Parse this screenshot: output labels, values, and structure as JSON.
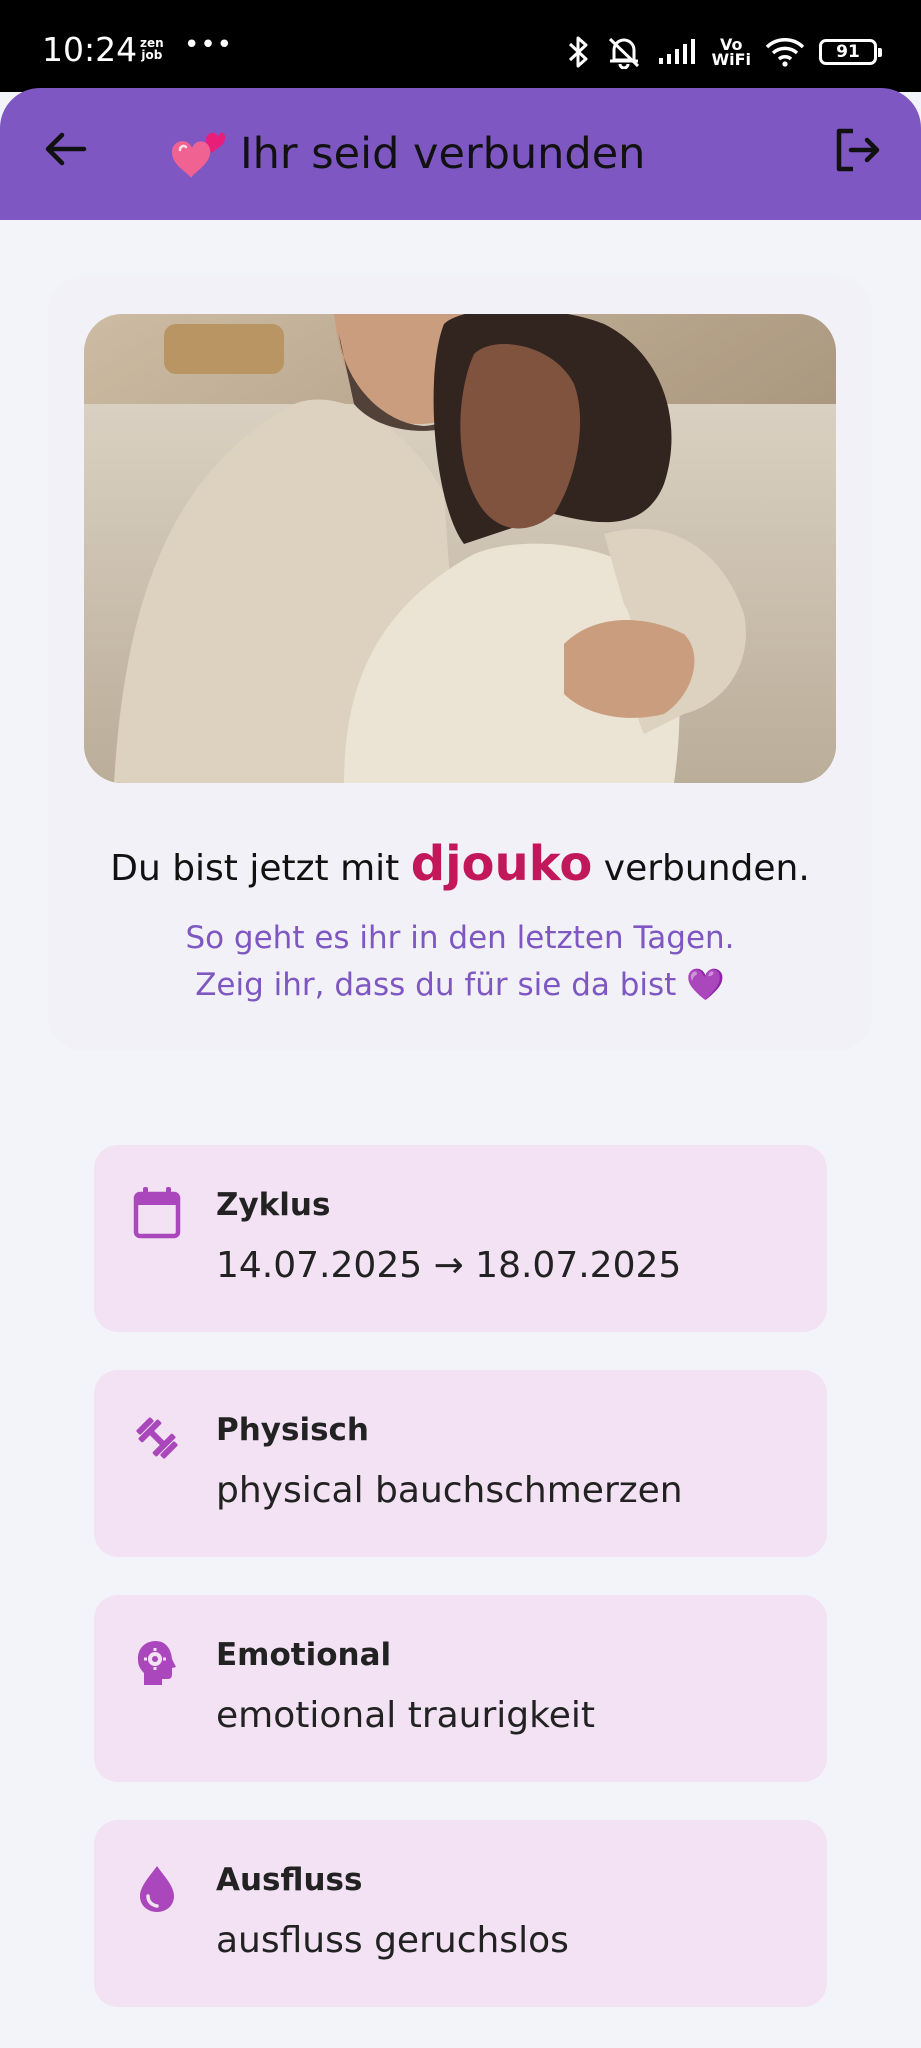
{
  "status_bar": {
    "time": "10:24",
    "carrier_badge_top": "zen",
    "carrier_badge_bottom": "job",
    "dots": "•••",
    "vowifi_top": "Vo",
    "vowifi_bottom": "WiFi",
    "battery": "91"
  },
  "app_bar": {
    "title": "Ihr seid verbunden"
  },
  "intro": {
    "connected_prefix": "Du bist jetzt mit",
    "partner_name": "djouko",
    "connected_suffix": "verbunden.",
    "subtitle_line1": "So geht es ihr in den letzten Tagen.",
    "subtitle_line2": "Zeig ihr, dass du für sie da bist 💜"
  },
  "cards": [
    {
      "icon": "calendar-icon",
      "title": "Zyklus",
      "value": "14.07.2025 → 18.07.2025"
    },
    {
      "icon": "dumbbell-icon",
      "title": "Physisch",
      "value": "physical bauchschmerzen"
    },
    {
      "icon": "head-gear-icon",
      "title": "Emotional",
      "value": "emotional traurigkeit"
    },
    {
      "icon": "drop-icon",
      "title": "Ausfluss",
      "value": "ausfluss geruchslos"
    }
  ],
  "colors": {
    "app_bar": "#7e57c2",
    "accent_name": "#c2185b",
    "subtitle": "#7e57c2",
    "card_bg": "#f2e2f4",
    "icon": "#ab47bc"
  }
}
